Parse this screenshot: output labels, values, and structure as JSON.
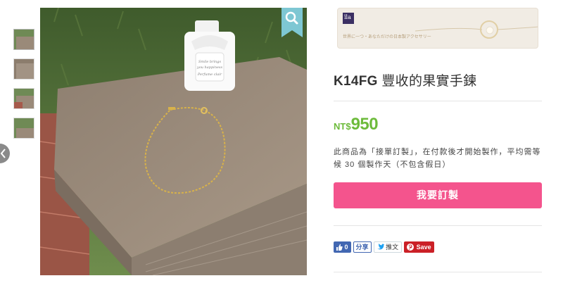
{
  "product": {
    "title_code": "K14FG",
    "title_name": "豐收的果實手鍊",
    "price_currency": "NT$",
    "price_amount": "950",
    "note": "此商品為「接單訂製」，在付款後才開始製作，平均需等候 30 個製作天（不包含假日）",
    "order_button": "我要訂製"
  },
  "main_image": {
    "bottle_lines": [
      "Smile brings",
      "you happiness",
      "Perfume clair"
    ]
  },
  "banner": {
    "logo_text": "ɪ̈la",
    "tagline": "世界に一つ・あなただけの日本製アクセサリー"
  },
  "thumbnails": [
    {
      "label": "thumbnail-1"
    },
    {
      "label": "thumbnail-2"
    },
    {
      "label": "thumbnail-3"
    },
    {
      "label": "thumbnail-4"
    }
  ],
  "social": {
    "like_count": "0",
    "share_label": "分享",
    "tweet_label": "推文",
    "pin_label": "Save"
  },
  "colors": {
    "price_green": "#6dbb3b",
    "order_pink": "#f4548d",
    "zoom_teal": "#7ec7d3",
    "facebook_blue": "#4267b2",
    "pinterest_red": "#cb2027"
  },
  "icons": [
    "chevron-left-icon",
    "zoom-icon",
    "thumbs-up-icon",
    "twitter-icon",
    "pinterest-icon"
  ]
}
